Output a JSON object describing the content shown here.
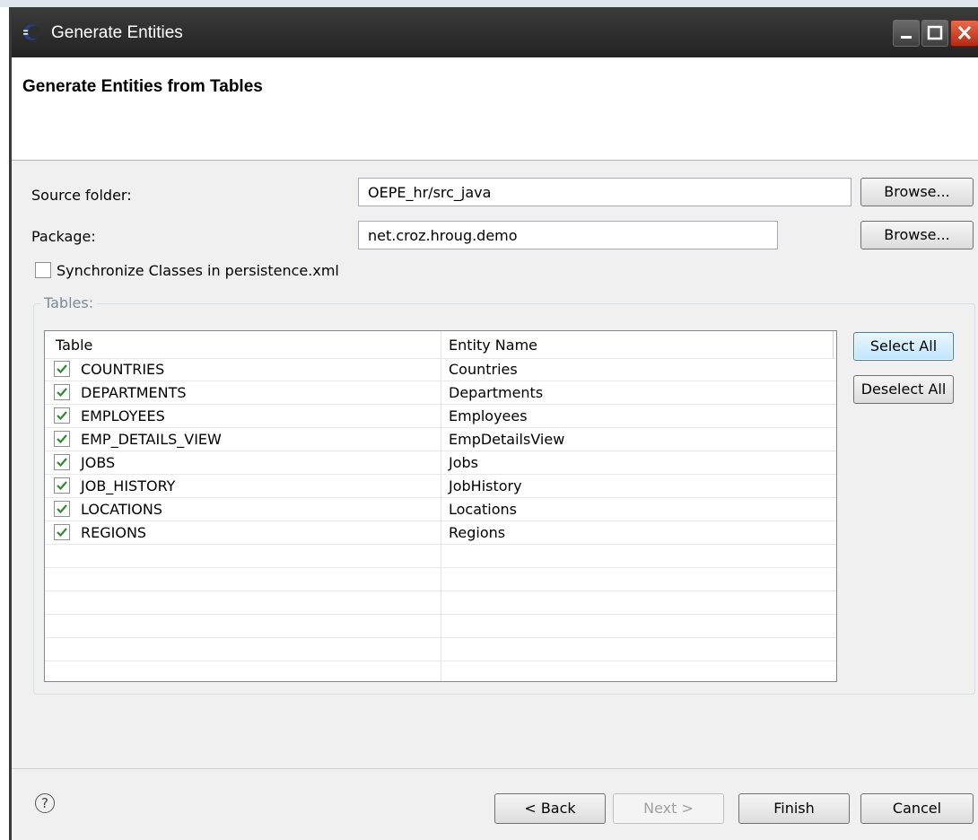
{
  "window": {
    "title": "Generate Entities"
  },
  "banner": {
    "heading": "Generate Entities from Tables"
  },
  "form": {
    "source_folder_label": "Source folder:",
    "source_folder_value": "OEPE_hr/src_java",
    "package_label": "Package:",
    "package_value": "net.croz.hroug.demo",
    "browse_label": "Browse...",
    "sync_label": "Synchronize Classes in persistence.xml",
    "sync_checked": false
  },
  "tables": {
    "group_label": "Tables:",
    "columns": [
      "Table",
      "Entity Name"
    ],
    "rows": [
      {
        "table": "COUNTRIES",
        "entity": "Countries",
        "checked": true
      },
      {
        "table": "DEPARTMENTS",
        "entity": "Departments",
        "checked": true
      },
      {
        "table": "EMPLOYEES",
        "entity": "Employees",
        "checked": true
      },
      {
        "table": "EMP_DETAILS_VIEW",
        "entity": "EmpDetailsView",
        "checked": true
      },
      {
        "table": "JOBS",
        "entity": "Jobs",
        "checked": true
      },
      {
        "table": "JOB_HISTORY",
        "entity": "JobHistory",
        "checked": true
      },
      {
        "table": "LOCATIONS",
        "entity": "Locations",
        "checked": true
      },
      {
        "table": "REGIONS",
        "entity": "Regions",
        "checked": true
      }
    ],
    "select_all_label": "Select All",
    "deselect_all_label": "Deselect All"
  },
  "footer": {
    "help_icon": "?",
    "back_label": "< Back",
    "next_label": "Next >",
    "finish_label": "Finish",
    "cancel_label": "Cancel"
  },
  "colors": {
    "title_bar": "#2e2e2e",
    "close_button": "#c8391c",
    "check_mark": "#2e8b2e",
    "group_label": "#7a8a9a"
  }
}
